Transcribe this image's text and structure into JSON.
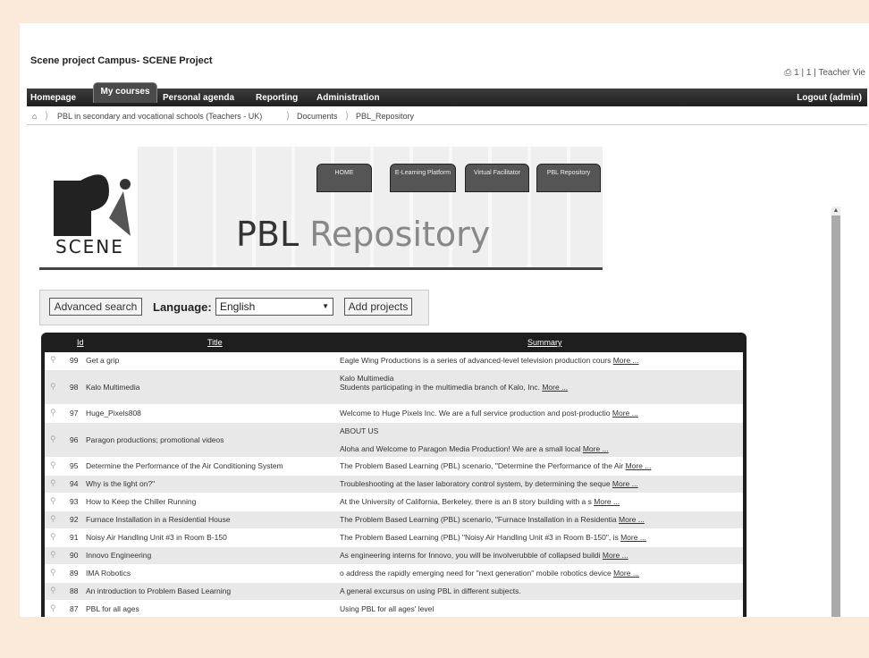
{
  "site_title": "Scene project Campus- SCENE Project",
  "topright": "1 | 1 | Teacher Vie",
  "nav": {
    "homepage": "Homepage",
    "my_courses": "My courses",
    "personal_agenda": "Personal agenda",
    "reporting": "Reporting",
    "administration": "Administration",
    "logout": "Logout (admin)"
  },
  "breadcrumb": {
    "course": "PBL in secondary and vocational schools (Teachers - UK)",
    "documents": "Documents",
    "repo": "PBL_Repository"
  },
  "banner": {
    "logo_text": "SCENE",
    "title_a": "PBL ",
    "title_b": "Repository",
    "buttons": [
      "HOME",
      "E-Learning Platform",
      "Virtual Facilitator",
      "PBL Repository"
    ]
  },
  "search": {
    "advanced_label": "Advanced search",
    "language_label": "Language:",
    "language_value": "English",
    "add_label": "Add projects"
  },
  "table": {
    "headers": {
      "id": "Id",
      "title": "Title",
      "summary": "Summary"
    },
    "more": "More ...",
    "rows": [
      {
        "id": "99",
        "title": "Get a grip",
        "summary": "Eagle Wing Productions is a series of advanced-level television production cours",
        "more": true
      },
      {
        "id": "98",
        "title": "Kalo Multimedia",
        "summary": "Kalo Multimedia",
        "summary2": "Students participating in the multimedia branch of Kalo, Inc.",
        "more": true
      },
      {
        "id": "97",
        "title": "Huge_Pixels808",
        "summary": "Welcome to Huge Pixels Inc. We are a full service production and post-productio",
        "more": true
      },
      {
        "id": "96",
        "title": "Paragon productions; promotional videos",
        "summary": "ABOUT US",
        "summary2": "Aloha and Welcome to Paragon Media Production! We are a small local",
        "more": true
      },
      {
        "id": "95",
        "title": "Determine the Performance of the Air Conditioning System",
        "summary": "The Problem Based Learning (PBL) scenario, \"Determine the Performance of the Air",
        "more": true
      },
      {
        "id": "94",
        "title": "Why is the light on?\"",
        "summary": "Troubleshooting at the laser laboratory control system, by determining the seque",
        "more": true
      },
      {
        "id": "93",
        "title": "How to Keep the Chiller Running",
        "summary": "At the University of California, Berkeley, there is an 8 story building with a s",
        "more": true
      },
      {
        "id": "92",
        "title": "Furnace Installation in a Residential House",
        "summary": "The Problem Based Learning (PBL) scenario, \"Furnace Installation in a Residentia",
        "more": true
      },
      {
        "id": "91",
        "title": "Noisy Air Handling Unit #3 in Room B-150",
        "summary": "The Problem Based Learning (PBL) \"Noisy Air Handling Unit #3 in Room B-150\", is",
        "more": true
      },
      {
        "id": "90",
        "title": "Innovo Engineering",
        "summary": "As engineering interns for Innovo, you will be involverubble of collapsed buildi",
        "more": true
      },
      {
        "id": "89",
        "title": "IMA Robotics",
        "summary": "o address the rapidly emerging need for \"next generation\" mobile robotics device",
        "more": true
      },
      {
        "id": "88",
        "title": "An introduction to Problem Based Learning",
        "summary": "A general excursus on using PBL in different subjects.",
        "more": false
      },
      {
        "id": "87",
        "title": "PBL for all ages",
        "summary": "Using PBL for all ages' level",
        "more": false
      }
    ]
  }
}
